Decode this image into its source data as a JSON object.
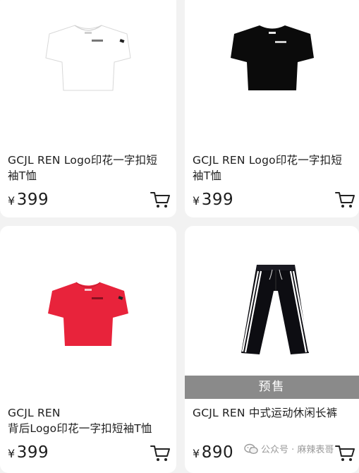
{
  "products": [
    {
      "title_line1": "GCJL REN Logo印花一字扣短",
      "title_line2": "袖T恤",
      "currency": "¥",
      "price": "399",
      "color": "#ffffff"
    },
    {
      "title_line1": "GCJL REN Logo印花一字扣短",
      "title_line2": "袖T恤",
      "currency": "¥",
      "price": "399",
      "color": "#0b0b0b"
    },
    {
      "title_line1": "GCJL REN",
      "title_line2": "背后Logo印花一字扣短袖T恤",
      "currency": "¥",
      "price": "399",
      "color": "#e8233b"
    },
    {
      "title_line1": "GCJL REN 中式运动休闲长裤",
      "title_line2": "",
      "currency": "¥",
      "price": "890",
      "badge": "预售",
      "color": "#0d0d12"
    }
  ],
  "watermark": {
    "text": "公众号 · 麻辣表哥",
    "icon": "wechat-icon"
  }
}
